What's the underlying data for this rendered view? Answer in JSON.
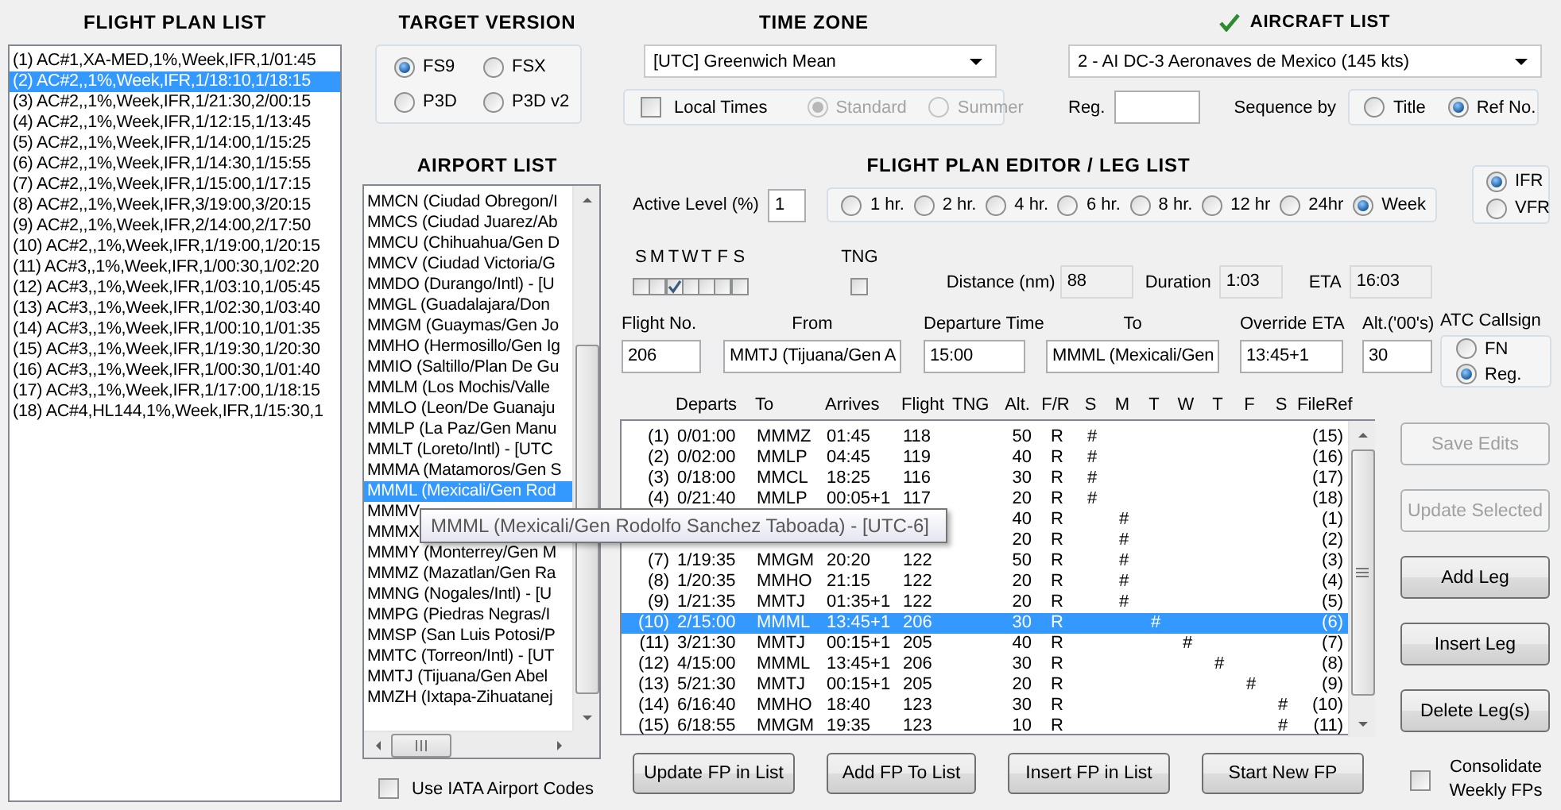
{
  "flight_plan_list": {
    "title": "FLIGHT PLAN LIST",
    "items": [
      {
        "text": "(1) AC#1,XA-MED,1%,Week,IFR,1/01:45",
        "selected": false
      },
      {
        "text": "(2) AC#2,,1%,Week,IFR,1/18:10,1/18:15",
        "selected": true
      },
      {
        "text": "(3) AC#2,,1%,Week,IFR,1/21:30,2/00:15",
        "selected": false
      },
      {
        "text": "(4) AC#2,,1%,Week,IFR,1/12:15,1/13:45",
        "selected": false
      },
      {
        "text": "(5) AC#2,,1%,Week,IFR,1/14:00,1/15:25",
        "selected": false
      },
      {
        "text": "(6) AC#2,,1%,Week,IFR,1/14:30,1/15:55",
        "selected": false
      },
      {
        "text": "(7) AC#2,,1%,Week,IFR,1/15:00,1/17:15",
        "selected": false
      },
      {
        "text": "(8) AC#2,,1%,Week,IFR,3/19:00,3/20:15",
        "selected": false
      },
      {
        "text": "(9) AC#2,,1%,Week,IFR,2/14:00,2/17:50",
        "selected": false
      },
      {
        "text": "(10) AC#2,,1%,Week,IFR,1/19:00,1/20:15",
        "selected": false
      },
      {
        "text": "(11) AC#3,,1%,Week,IFR,1/00:30,1/02:20",
        "selected": false
      },
      {
        "text": "(12) AC#3,,1%,Week,IFR,1/03:10,1/05:45",
        "selected": false
      },
      {
        "text": "(13) AC#3,,1%,Week,IFR,1/02:30,1/03:40",
        "selected": false
      },
      {
        "text": "(14) AC#3,,1%,Week,IFR,1/00:10,1/01:35",
        "selected": false
      },
      {
        "text": "(15) AC#3,,1%,Week,IFR,1/19:30,1/20:30",
        "selected": false
      },
      {
        "text": "(16) AC#3,,1%,Week,IFR,1/00:30,1/01:40",
        "selected": false
      },
      {
        "text": "(17) AC#3,,1%,Week,IFR,1/17:00,1/18:15",
        "selected": false
      },
      {
        "text": "(18) AC#4,HL144,1%,Week,IFR,1/15:30,1",
        "selected": false
      }
    ]
  },
  "target_version": {
    "title": "TARGET VERSION",
    "options": [
      {
        "label": "FS9",
        "selected": true
      },
      {
        "label": "FSX",
        "selected": false
      },
      {
        "label": "P3D",
        "selected": false
      },
      {
        "label": "P3D v2",
        "selected": false
      }
    ]
  },
  "airport_list": {
    "title": "AIRPORT LIST",
    "items": [
      {
        "text": "MMCN (Ciudad Obregon/I",
        "selected": false
      },
      {
        "text": "MMCS (Ciudad Juarez/Ab",
        "selected": false
      },
      {
        "text": "MMCU (Chihuahua/Gen D",
        "selected": false
      },
      {
        "text": "MMCV (Ciudad Victoria/G",
        "selected": false
      },
      {
        "text": "MMDO (Durango/Intl) - [U",
        "selected": false
      },
      {
        "text": "MMGL (Guadalajara/Don",
        "selected": false
      },
      {
        "text": "MMGM (Guaymas/Gen Jo",
        "selected": false
      },
      {
        "text": "MMHO (Hermosillo/Gen Ig",
        "selected": false
      },
      {
        "text": "MMIO (Saltillo/Plan De Gu",
        "selected": false
      },
      {
        "text": "MMLM (Los Mochis/Valle",
        "selected": false
      },
      {
        "text": "MMLO (Leon/De Guanaju",
        "selected": false
      },
      {
        "text": "MMLP (La Paz/Gen Manu",
        "selected": false
      },
      {
        "text": "MMLT (Loreto/Intl) - [UTC",
        "selected": false
      },
      {
        "text": "MMMA (Matamoros/Gen S",
        "selected": false
      },
      {
        "text": "MMML (Mexicali/Gen Rod",
        "selected": true
      },
      {
        "text": "MMMV",
        "selected": false
      },
      {
        "text": "MMMX",
        "selected": false
      },
      {
        "text": "MMMY (Monterrey/Gen M",
        "selected": false
      },
      {
        "text": "MMMZ (Mazatlan/Gen Ra",
        "selected": false
      },
      {
        "text": "MMNG (Nogales/Intl) - [U",
        "selected": false
      },
      {
        "text": "MMPG (Piedras Negras/I",
        "selected": false
      },
      {
        "text": "MMSP (San Luis Potosi/P",
        "selected": false
      },
      {
        "text": "MMTC (Torreon/Intl) - [UT",
        "selected": false
      },
      {
        "text": "MMTJ (Tijuana/Gen Abel",
        "selected": false
      },
      {
        "text": "MMZH (Ixtapa-Zihuatanej",
        "selected": false
      }
    ],
    "tooltip": "MMML (Mexicali/Gen Rodolfo Sanchez Taboada) - [UTC-6]",
    "use_iata": {
      "label": "Use IATA Airport Codes",
      "checked": false
    }
  },
  "time_zone": {
    "title": "TIME ZONE",
    "value": "[UTC] Greenwich Mean",
    "local_times": {
      "label": "Local Times",
      "checked": false
    },
    "modes": [
      {
        "label": "Standard",
        "selected": true,
        "disabled": true
      },
      {
        "label": "Summer",
        "selected": false,
        "disabled": true
      }
    ]
  },
  "aircraft_list": {
    "title": "AIRCRAFT LIST",
    "value": "2 - AI DC-3 Aeronaves de Mexico (145 kts)",
    "reg_label": "Reg.",
    "sequence_label": "Sequence by",
    "sequence": [
      {
        "label": "Title",
        "selected": false
      },
      {
        "label": "Ref No.",
        "selected": true
      }
    ]
  },
  "editor": {
    "title": "FLIGHT PLAN EDITOR / LEG LIST",
    "active_level_label": "Active Level (%)",
    "active_level": "1",
    "intervals": [
      {
        "label": "1 hr.",
        "selected": false
      },
      {
        "label": "2 hr.",
        "selected": false
      },
      {
        "label": "4 hr.",
        "selected": false
      },
      {
        "label": "6 hr.",
        "selected": false
      },
      {
        "label": "8 hr.",
        "selected": false
      },
      {
        "label": "12 hr",
        "selected": false
      },
      {
        "label": "24hr",
        "selected": false
      },
      {
        "label": "Week",
        "selected": true
      }
    ],
    "rules": [
      {
        "label": "IFR",
        "selected": true
      },
      {
        "label": "VFR",
        "selected": false
      }
    ],
    "days": [
      {
        "label": "S",
        "checked": false
      },
      {
        "label": "M",
        "checked": false
      },
      {
        "label": "T",
        "checked": true
      },
      {
        "label": "W",
        "checked": false
      },
      {
        "label": "T",
        "checked": false
      },
      {
        "label": "F",
        "checked": false
      },
      {
        "label": "S",
        "checked": false
      }
    ],
    "tng": {
      "label": "TNG",
      "checked": false
    },
    "distance": {
      "label": "Distance (nm)",
      "value": "88"
    },
    "duration": {
      "label": "Duration",
      "value": "1:03"
    },
    "eta": {
      "label": "ETA",
      "value": "16:03"
    },
    "fields": [
      {
        "label": "Flight No.",
        "value": "206"
      },
      {
        "label": "From",
        "value": "MMTJ (Tijuana/Gen A"
      },
      {
        "label": "Departure Time",
        "value": "15:00"
      },
      {
        "label": "To",
        "value": "MMML (Mexicali/Gen"
      },
      {
        "label": "Override ETA",
        "value": "13:45+1"
      },
      {
        "label": "Alt.('00's)",
        "value": "30"
      }
    ],
    "atc": {
      "label": "ATC Callsign",
      "options": [
        {
          "label": "FN",
          "selected": false
        },
        {
          "label": "Reg.",
          "selected": true
        }
      ]
    }
  },
  "leg_list": {
    "columns": [
      "Departs",
      "To",
      "Arrives",
      "Flight",
      "TNG",
      "Alt.",
      "F/R",
      "S",
      "M",
      "T",
      "W",
      "T",
      "F",
      "S",
      "FileRef"
    ],
    "rows": [
      {
        "num": "(1)",
        "departs": "0/01:00",
        "to": "MMMZ",
        "arrives": "01:45",
        "flight": "118",
        "alt": "50",
        "fr": "R",
        "sun": "#",
        "fileref": "(15)",
        "selected": false
      },
      {
        "num": "(2)",
        "departs": "0/02:00",
        "to": "MMLP",
        "arrives": "04:45",
        "flight": "119",
        "alt": "40",
        "fr": "R",
        "sun": "#",
        "fileref": "(16)",
        "selected": false
      },
      {
        "num": "(3)",
        "departs": "0/18:00",
        "to": "MMCL",
        "arrives": "18:25",
        "flight": "116",
        "alt": "30",
        "fr": "R",
        "sun": "#",
        "fileref": "(17)",
        "selected": false
      },
      {
        "num": "(4)",
        "departs": "0/21:40",
        "to": "MMLP",
        "arrives": "00:05+1",
        "flight": "117",
        "alt": "20",
        "fr": "R",
        "sun": "#",
        "fileref": "(18)",
        "selected": false
      },
      {
        "alt": "40",
        "fr": "R",
        "mon": "#",
        "fileref": "(1)",
        "selected": false
      },
      {
        "alt": "20",
        "fr": "R",
        "mon": "#",
        "fileref": "(2)",
        "selected": false
      },
      {
        "num": "(7)",
        "departs": "1/19:35",
        "to": "MMGM",
        "arrives": "20:20",
        "flight": "122",
        "alt": "50",
        "fr": "R",
        "mon": "#",
        "fileref": "(3)",
        "selected": false
      },
      {
        "num": "(8)",
        "departs": "1/20:35",
        "to": "MMHO",
        "arrives": "21:15",
        "flight": "122",
        "alt": "20",
        "fr": "R",
        "mon": "#",
        "fileref": "(4)",
        "selected": false
      },
      {
        "num": "(9)",
        "departs": "1/21:35",
        "to": "MMTJ",
        "arrives": "01:35+1",
        "flight": "122",
        "alt": "20",
        "fr": "R",
        "mon": "#",
        "fileref": "(5)",
        "selected": false
      },
      {
        "num": "(10)",
        "departs": "2/15:00",
        "to": "MMML",
        "arrives": "13:45+1",
        "flight": "206",
        "alt": "30",
        "fr": "R",
        "tue": "#",
        "fileref": "(6)",
        "selected": true
      },
      {
        "num": "(11)",
        "departs": "3/21:30",
        "to": "MMTJ",
        "arrives": "00:15+1",
        "flight": "205",
        "alt": "40",
        "fr": "R",
        "wed": "#",
        "fileref": "(7)",
        "selected": false
      },
      {
        "num": "(12)",
        "departs": "4/15:00",
        "to": "MMML",
        "arrives": "13:45+1",
        "flight": "206",
        "alt": "30",
        "fr": "R",
        "thu": "#",
        "fileref": "(8)",
        "selected": false
      },
      {
        "num": "(13)",
        "departs": "5/21:30",
        "to": "MMTJ",
        "arrives": "00:15+1",
        "flight": "205",
        "alt": "20",
        "fr": "R",
        "fri": "#",
        "fileref": "(9)",
        "selected": false
      },
      {
        "num": "(14)",
        "departs": "6/16:40",
        "to": "MMHO",
        "arrives": "18:40",
        "flight": "123",
        "alt": "30",
        "fr": "R",
        "sat": "#",
        "fileref": "(10)",
        "selected": false
      },
      {
        "num": "(15)",
        "departs": "6/18:55",
        "to": "MMGM",
        "arrives": "19:35",
        "flight": "123",
        "alt": "10",
        "fr": "R",
        "sat": "#",
        "fileref": "(11)",
        "selected": false
      }
    ]
  },
  "side_buttons": [
    {
      "label": "Save Edits",
      "disabled": true
    },
    {
      "label": "Update Selected",
      "disabled": true
    },
    {
      "label": "Add Leg",
      "disabled": false
    },
    {
      "label": "Insert Leg",
      "disabled": false
    },
    {
      "label": "Delete Leg(s)",
      "disabled": false
    }
  ],
  "consolidate": {
    "label": "Consolidate Weekly FPs",
    "checked": false
  },
  "bottom_buttons": [
    {
      "label": "Update FP in List"
    },
    {
      "label": "Add FP To List"
    },
    {
      "label": "Insert FP in List"
    },
    {
      "label": "Start New FP"
    }
  ]
}
